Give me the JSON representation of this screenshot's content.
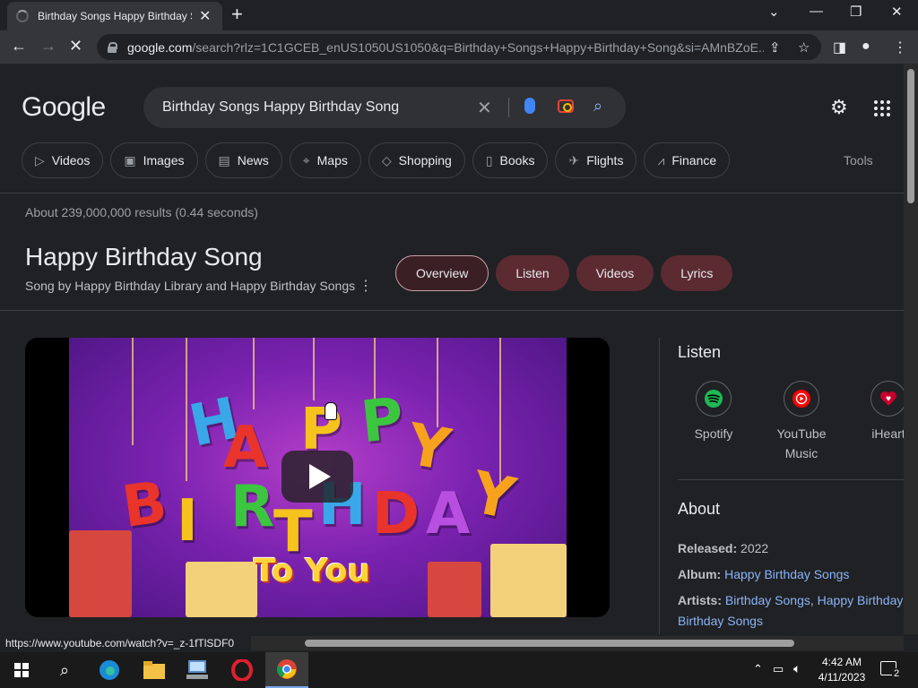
{
  "browser": {
    "tab_title": "Birthday Songs Happy Birthday S",
    "url_host": "google.com",
    "url_rest": "/search?rlz=1C1GCEB_enUS1050US1050&q=Birthday+Songs+Happy+Birthday+Song&si=AMnBZoE..."
  },
  "search": {
    "logo": "Google",
    "query": "Birthday Songs Happy Birthday Song",
    "chips": [
      "Videos",
      "Images",
      "News",
      "Maps",
      "Shopping",
      "Books",
      "Flights",
      "Finance"
    ],
    "tools": "Tools",
    "stats": "About 239,000,000 results (0.44 seconds)"
  },
  "knowledge_panel": {
    "title": "Happy Birthday Song",
    "subtitle": "Song by Happy Birthday Library and Happy Birthday Songs",
    "pills": [
      "Overview",
      "Listen",
      "Videos",
      "Lyrics"
    ]
  },
  "video": {
    "letters_row1": [
      "H",
      "A",
      "P",
      "P",
      "Y"
    ],
    "letters_row2": [
      "B",
      "I",
      "R",
      "T",
      "H",
      "D",
      "A",
      "Y"
    ],
    "tagline": "To You"
  },
  "listen": {
    "heading": "Listen",
    "services": [
      {
        "name": "Spotify",
        "icon": "spotify-icon",
        "color": "#1db954"
      },
      {
        "name": "YouTube Music",
        "icon": "youtube-music-icon",
        "color": "#ff0000"
      },
      {
        "name": "iHeart",
        "icon": "iheartradio-icon",
        "color": "#c6002b"
      }
    ]
  },
  "about": {
    "heading": "About",
    "released_label": "Released:",
    "released_value": "2022",
    "album_label": "Album:",
    "album_value": "Happy Birthday Songs",
    "artists_label": "Artists:",
    "artist1": "Birthday Songs",
    "artist2_start": "Happy Birthday L",
    "artist2_end": "Birthday Songs"
  },
  "status_url": "https://www.youtube.com/watch?v=_z-1fTlSDF0",
  "taskbar": {
    "time": "4:42 AM",
    "date": "4/11/2023",
    "notification_count": "2"
  }
}
